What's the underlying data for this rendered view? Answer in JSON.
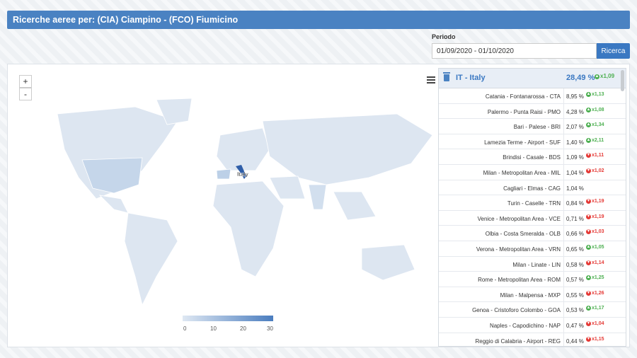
{
  "header": {
    "title": "Ricerche aeree per: (CIA) Ciampino - (FCO) Fiumicino"
  },
  "period": {
    "label": "Periodo",
    "value": "01/09/2020 - 01/10/2020",
    "button": "Ricerca"
  },
  "map": {
    "zoom_in": "+",
    "zoom_out": "-",
    "highlight_label": "Italy",
    "legend_ticks": [
      "0",
      "10",
      "20",
      "30"
    ],
    "colors": {
      "low": "#dfe8f3",
      "high": "#4a7dbf",
      "italy": "#2f5ea8"
    }
  },
  "list": {
    "header": {
      "label": "IT - Italy",
      "value": "28,49 %",
      "trend": "x1,09",
      "trend_dir": "up"
    },
    "rows": [
      {
        "name": "Catania - Fontanarossa - CTA",
        "pct": "8,95 %",
        "trend": "x1,13",
        "dir": "up"
      },
      {
        "name": "Palermo - Punta Raisi - PMO",
        "pct": "4,28 %",
        "trend": "x1,08",
        "dir": "up"
      },
      {
        "name": "Bari - Palese - BRI",
        "pct": "2,07 %",
        "trend": "x1,34",
        "dir": "up"
      },
      {
        "name": "Lamezia Terme - Airport - SUF",
        "pct": "1,40 %",
        "trend": "x2,11",
        "dir": "up"
      },
      {
        "name": "Brindisi - Casale - BDS",
        "pct": "1,09 %",
        "trend": "x1,11",
        "dir": "down"
      },
      {
        "name": "Milan - Metropolitan Area - MIL",
        "pct": "1,04 %",
        "trend": "x1,02",
        "dir": "down"
      },
      {
        "name": "Cagliari - Elmas - CAG",
        "pct": "1,04 %",
        "trend": "",
        "dir": ""
      },
      {
        "name": "Turin - Caselle - TRN",
        "pct": "0,84 %",
        "trend": "x1,19",
        "dir": "down"
      },
      {
        "name": "Venice - Metropolitan Area - VCE",
        "pct": "0,71 %",
        "trend": "x1,19",
        "dir": "down"
      },
      {
        "name": "Olbia - Costa Smeralda - OLB",
        "pct": "0,66 %",
        "trend": "x1,03",
        "dir": "down"
      },
      {
        "name": "Verona - Metropolitan Area - VRN",
        "pct": "0,65 %",
        "trend": "x1,05",
        "dir": "up"
      },
      {
        "name": "Milan - Linate - LIN",
        "pct": "0,58 %",
        "trend": "x1,14",
        "dir": "down"
      },
      {
        "name": "Rome - Metropolitan Area - ROM",
        "pct": "0,57 %",
        "trend": "x1,25",
        "dir": "up"
      },
      {
        "name": "Milan - Malpensa - MXP",
        "pct": "0,55 %",
        "trend": "x1,26",
        "dir": "down"
      },
      {
        "name": "Genoa - Cristoforo Colombo - GOA",
        "pct": "0,53 %",
        "trend": "x1,17",
        "dir": "up"
      },
      {
        "name": "Naples - Capodichino - NAP",
        "pct": "0,47 %",
        "trend": "x1,04",
        "dir": "down"
      },
      {
        "name": "Reggio di Calabria - Airport - REG",
        "pct": "0,44 %",
        "trend": "x1,15",
        "dir": "down"
      }
    ]
  }
}
